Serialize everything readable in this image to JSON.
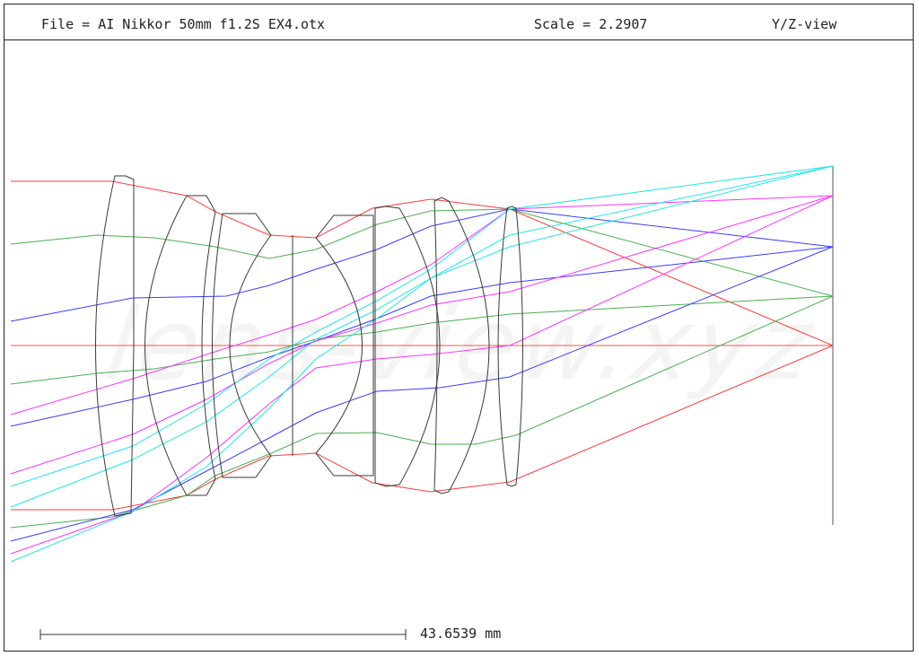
{
  "header": {
    "file_label": "File = AI Nikkor 50mm f1.2S EX4.otx",
    "scale_label": "Scale = 2.2907",
    "view_label": "Y/Z-view"
  },
  "watermark": "lens-view.xyz",
  "scale_bar": {
    "label": "43.6539 mm"
  },
  "colors": {
    "lens_outline": "#3a3a3a",
    "ray_red": "#ff3b3b",
    "ray_green": "#4caf50",
    "ray_blue": "#3b3bff",
    "ray_magenta": "#ff33ff",
    "ray_cyan": "#22e6e6",
    "axis": "#ff5050"
  }
}
